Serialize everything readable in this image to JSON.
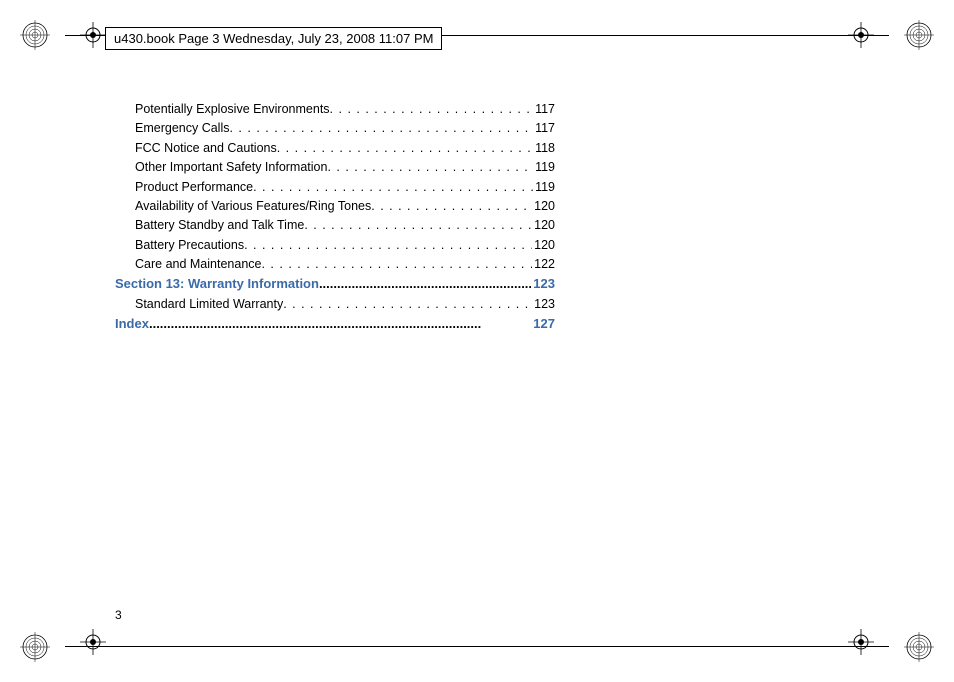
{
  "header": "u430.book  Page 3  Wednesday, July 23, 2008  11:07 PM",
  "toc": {
    "items": [
      {
        "title": "Potentially Explosive Environments",
        "page": "117",
        "type": "sub"
      },
      {
        "title": "Emergency Calls",
        "page": "117",
        "type": "sub"
      },
      {
        "title": "FCC Notice and Cautions ",
        "page": "118",
        "type": "sub"
      },
      {
        "title": "Other Important Safety Information",
        "page": "119",
        "type": "sub"
      },
      {
        "title": "Product Performance ",
        "page": "119",
        "type": "sub"
      },
      {
        "title": "Availability of Various Features/Ring Tones",
        "page": "120",
        "type": "sub"
      },
      {
        "title": "Battery Standby and Talk Time",
        "page": "120",
        "type": "sub"
      },
      {
        "title": "Battery Precautions ",
        "page": "120",
        "type": "sub"
      },
      {
        "title": "Care and Maintenance",
        "page": "122",
        "type": "sub"
      },
      {
        "title": "Section 13:  Warranty Information ",
        "page": "123",
        "type": "section"
      },
      {
        "title": "Standard Limited Warranty",
        "page": "123",
        "type": "sub"
      },
      {
        "title": "Index ",
        "page": "127",
        "type": "section"
      }
    ]
  },
  "pageNumber": "3"
}
